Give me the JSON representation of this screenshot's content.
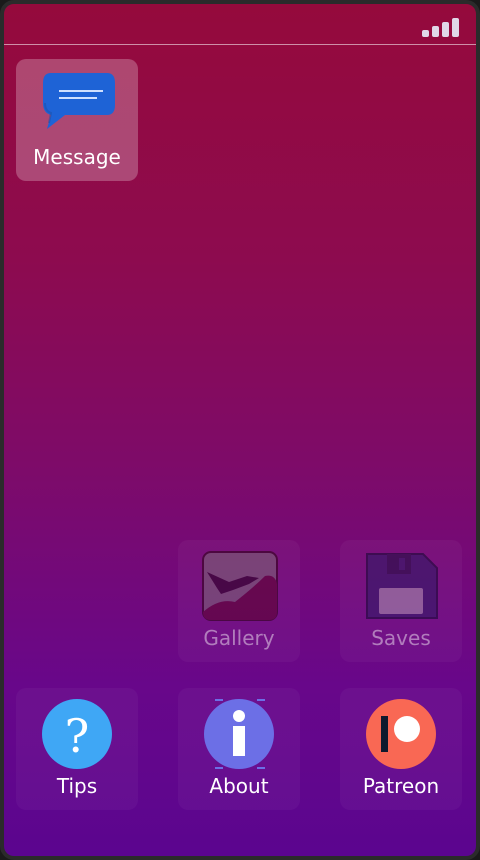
{
  "status_bar": {
    "signal_icon": "signal-bars-icon"
  },
  "apps": {
    "message": {
      "label": "Message",
      "icon": "chat-bubble-icon",
      "color": "#1e63d6"
    },
    "gallery": {
      "label": "Gallery",
      "icon": "gallery-icon"
    },
    "saves": {
      "label": "Saves",
      "icon": "floppy-disk-icon",
      "color": "#2a1b63"
    },
    "tips": {
      "label": "Tips",
      "icon": "question-mark-icon",
      "color": "#3fa7f5"
    },
    "about": {
      "label": "About",
      "icon": "info-icon",
      "color": "#6c6fe6"
    },
    "patreon": {
      "label": "Patreon",
      "icon": "patreon-logo-icon",
      "color": "#f96854"
    }
  }
}
